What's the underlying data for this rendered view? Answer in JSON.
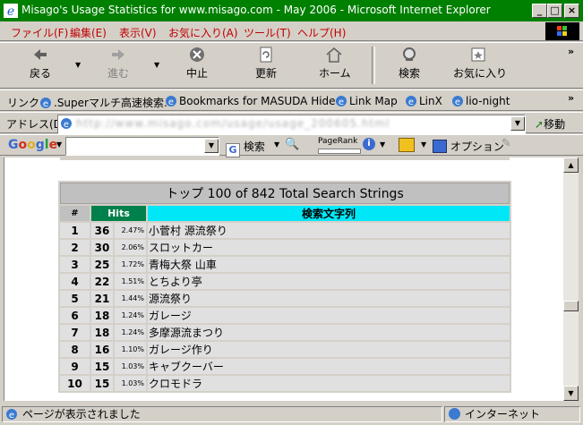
{
  "window": {
    "title": "Misago's Usage Statistics for www.misago.com - May 2006 - Microsoft Internet Explorer",
    "controls": {
      "minimize": "_",
      "maximize": "□",
      "close": "×"
    }
  },
  "menu": {
    "items": [
      "ファイル(F)",
      "編集(E)",
      "表示(V)",
      "お気に入り(A)",
      "ツール(T)",
      "ヘルプ(H)"
    ]
  },
  "toolbar": {
    "back": "戻る",
    "forward": "進む",
    "stop": "中止",
    "refresh": "更新",
    "home": "ホーム",
    "search": "検索",
    "favorites": "お気に入り"
  },
  "links": {
    "label": "リンク",
    "items": [
      ".Superマルチ高速検索.",
      "Bookmarks for MASUDA Hideo",
      "Link Map",
      "LinX",
      "lio-night"
    ]
  },
  "address": {
    "label": "アドレス(D)",
    "value": "http://www.misago.com/usage/usage_200605.html",
    "go": "移動"
  },
  "google": {
    "logo": "Google",
    "search": "検索",
    "pagerank": "PageRank",
    "options": "オプション"
  },
  "stats": {
    "caption": "トップ 100 of 842 Total Search Strings",
    "headers": {
      "num": "#",
      "hits": "Hits",
      "term": "検索文字列"
    },
    "rows": [
      {
        "num": "1",
        "hits": "36",
        "pct": "2.47%",
        "term": "小菅村 源流祭り"
      },
      {
        "num": "2",
        "hits": "30",
        "pct": "2.06%",
        "term": "スロットカー"
      },
      {
        "num": "3",
        "hits": "25",
        "pct": "1.72%",
        "term": "青梅大祭 山車"
      },
      {
        "num": "4",
        "hits": "22",
        "pct": "1.51%",
        "term": "とちより亭"
      },
      {
        "num": "5",
        "hits": "21",
        "pct": "1.44%",
        "term": "源流祭り"
      },
      {
        "num": "6",
        "hits": "18",
        "pct": "1.24%",
        "term": "ガレージ"
      },
      {
        "num": "7",
        "hits": "18",
        "pct": "1.24%",
        "term": "多摩源流まつり"
      },
      {
        "num": "8",
        "hits": "16",
        "pct": "1.10%",
        "term": "ガレージ作り"
      },
      {
        "num": "9",
        "hits": "15",
        "pct": "1.03%",
        "term": "キャブクーバー"
      },
      {
        "num": "10",
        "hits": "15",
        "pct": "1.03%",
        "term": "クロモドラ"
      }
    ]
  },
  "status": {
    "message": "ページが表示されました",
    "zone": "インターネット"
  },
  "colors": {
    "titlebar": "#008000",
    "menu_text": "#c00000",
    "hits_header": "#00804a",
    "term_header": "#00e8f8"
  }
}
